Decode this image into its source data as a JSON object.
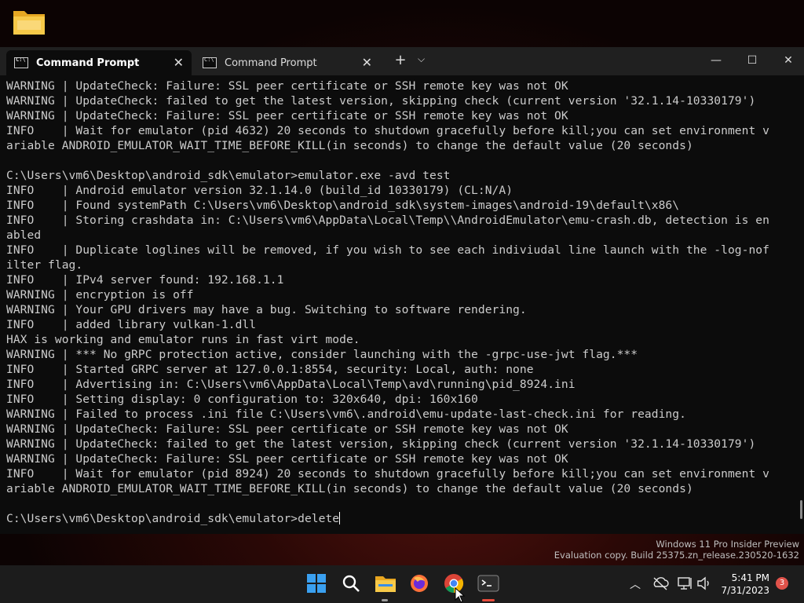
{
  "desktop": {
    "folder_icon": "folder-icon"
  },
  "window": {
    "tabs": [
      {
        "label": "Command Prompt",
        "active": true
      },
      {
        "label": "Command Prompt",
        "active": false
      }
    ],
    "new_tab_glyph": "+",
    "dropdown_glyph": "⌵",
    "controls": {
      "minimize": "—",
      "maximize": "☐",
      "close": "✕"
    }
  },
  "terminal": {
    "lines": [
      "WARNING | UpdateCheck: Failure: SSL peer certificate or SSH remote key was not OK",
      "WARNING | UpdateCheck: failed to get the latest version, skipping check (current version '32.1.14-10330179')",
      "WARNING | UpdateCheck: Failure: SSL peer certificate or SSH remote key was not OK",
      "INFO    | Wait for emulator (pid 4632) 20 seconds to shutdown gracefully before kill;you can set environment v",
      "ariable ANDROID_EMULATOR_WAIT_TIME_BEFORE_KILL(in seconds) to change the default value (20 seconds)",
      "",
      "C:\\Users\\vm6\\Desktop\\android_sdk\\emulator>emulator.exe -avd test",
      "INFO    | Android emulator version 32.1.14.0 (build_id 10330179) (CL:N/A)",
      "INFO    | Found systemPath C:\\Users\\vm6\\Desktop\\android_sdk\\system-images\\android-19\\default\\x86\\",
      "INFO    | Storing crashdata in: C:\\Users\\vm6\\AppData\\Local\\Temp\\\\AndroidEmulator\\emu-crash.db, detection is en",
      "abled",
      "INFO    | Duplicate loglines will be removed, if you wish to see each indiviudal line launch with the -log-nof",
      "ilter flag.",
      "INFO    | IPv4 server found: 192.168.1.1",
      "WARNING | encryption is off",
      "WARNING | Your GPU drivers may have a bug. Switching to software rendering.",
      "INFO    | added library vulkan-1.dll",
      "HAX is working and emulator runs in fast virt mode.",
      "WARNING | *** No gRPC protection active, consider launching with the -grpc-use-jwt flag.***",
      "INFO    | Started GRPC server at 127.0.0.1:8554, security: Local, auth: none",
      "INFO    | Advertising in: C:\\Users\\vm6\\AppData\\Local\\Temp\\avd\\running\\pid_8924.ini",
      "INFO    | Setting display: 0 configuration to: 320x640, dpi: 160x160",
      "WARNING | Failed to process .ini file C:\\Users\\vm6\\.android\\emu-update-last-check.ini for reading.",
      "WARNING | UpdateCheck: Failure: SSL peer certificate or SSH remote key was not OK",
      "WARNING | UpdateCheck: failed to get the latest version, skipping check (current version '32.1.14-10330179')",
      "WARNING | UpdateCheck: Failure: SSL peer certificate or SSH remote key was not OK",
      "INFO    | Wait for emulator (pid 8924) 20 seconds to shutdown gracefully before kill;you can set environment v",
      "ariable ANDROID_EMULATOR_WAIT_TIME_BEFORE_KILL(in seconds) to change the default value (20 seconds)",
      ""
    ],
    "prompt": "C:\\Users\\vm6\\Desktop\\android_sdk\\emulator>",
    "input": "delete"
  },
  "watermark": {
    "line1": "Windows 11 Pro Insider Preview",
    "line2": "Evaluation copy. Build 25375.zn_release.230520-1632"
  },
  "taskbar": {
    "apps": [
      "start-icon",
      "search-icon",
      "file-explorer-icon",
      "firefox-icon",
      "chrome-icon",
      "terminal-icon"
    ],
    "tray": {
      "chevron": "︿"
    },
    "clock": {
      "time": "5:41 PM",
      "date": "7/31/2023"
    },
    "notification_count": "3"
  },
  "colors": {
    "terminal_bg": "#0c0c0c",
    "terminal_fg": "#cccccc",
    "taskbar_bg": "#1c1c1c",
    "accent": "#e84b3c"
  }
}
